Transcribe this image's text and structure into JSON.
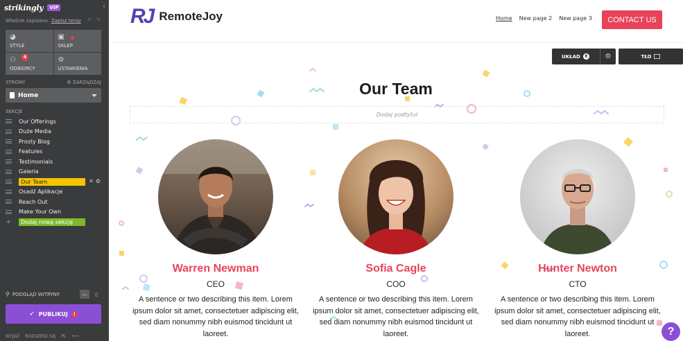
{
  "editor": {
    "brand": "strikingly",
    "vip_label": "VIP",
    "saved_text": "Właśnie zapisano.",
    "save_now_link": "Zapisz teraz",
    "tools": [
      {
        "label": "STYLE",
        "icon": "palette-icon"
      },
      {
        "label": "SKLEP",
        "icon": "bag-icon"
      },
      {
        "label": "ODBIORCY",
        "icon": "people-icon",
        "badge": "4"
      },
      {
        "label": "USTAWIENIA",
        "icon": "gear-icon"
      }
    ],
    "pages_label": "STRONY",
    "manage_label": "ZARZĄDZAJ",
    "current_page": "Home",
    "sections_label": "SEKCJE",
    "sections": [
      "Our Offerings",
      "Duże Media",
      "Prosty Blog",
      "Features",
      "Testimonials",
      "Galeria",
      "Our Team",
      "Osadź Aplikacje",
      "Reach Out",
      "Make Your Own"
    ],
    "active_section": "Our Team",
    "add_section_label": "Dodaj nową sekcję",
    "preview_label": "PODGLĄD WITRYNY",
    "publish_label": "PUBLIKUJ",
    "footer": [
      "WYJDŹ",
      "ROZSZERZ SIĘ",
      "PL",
      "•••"
    ]
  },
  "site": {
    "brand_mark": "RJ",
    "brand_name": "RemoteJoy",
    "nav": [
      "Home",
      "New page 2",
      "New page 3"
    ],
    "cta_label": "CONTACT US",
    "layout_label": "UKŁAD",
    "layout_count": "8",
    "background_label": "TŁO",
    "section_title": "Our Team",
    "subtitle_placeholder": "Dodaj podtytuł",
    "members": [
      {
        "name": "Warren Newman",
        "role": "CEO",
        "description": "A sentence or two describing this item. Lorem ipsum dolor sit amet, consectetuer adipiscing elit, sed diam nonummy nibh euismod tincidunt ut laoreet."
      },
      {
        "name": "Sofia Cagle",
        "role": "COO",
        "description": "A sentence or two describing this item. Lorem ipsum dolor sit amet, consectetuer adipiscing elit, sed diam nonummy nibh euismod tincidunt ut laoreet."
      },
      {
        "name": "Hunter Newton",
        "role": "CTO",
        "description": "A sentence or two describing this item. Lorem ipsum dolor sit amet, consectetuer adipiscing elit, sed diam nonummy nibh euismod tincidunt ut laoreet."
      }
    ],
    "help_label": "?"
  },
  "colors": {
    "accent_pink": "#e8435a",
    "brand_purple": "#5a3fb5",
    "publish_purple": "#8b4fd6",
    "active_yellow": "#f5c400",
    "add_green": "#7dba2a"
  }
}
